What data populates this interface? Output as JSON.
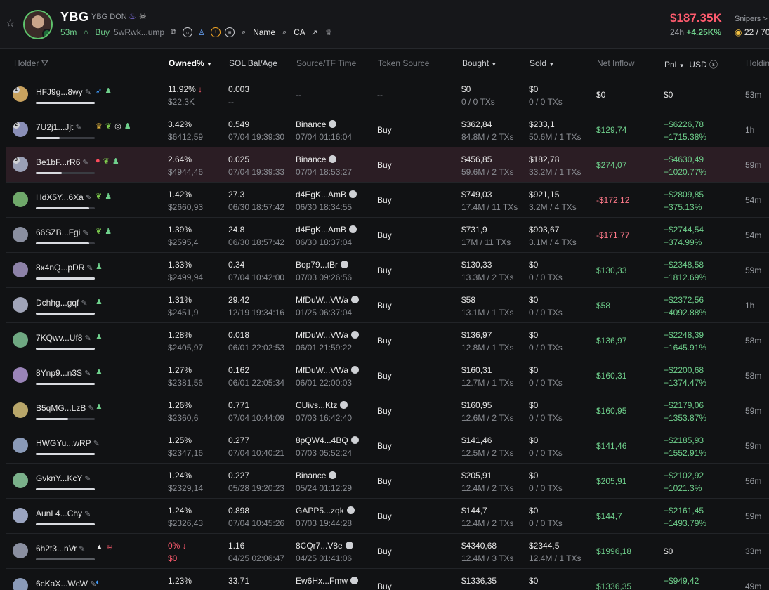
{
  "header": {
    "symbol": "YBG",
    "name": "YBG DON",
    "age": "53m",
    "buy_label": "Buy",
    "address": "5wRwk...ump",
    "name_link": "Name",
    "ca_link": "CA",
    "price": "$187.35K",
    "change_period": "24h",
    "change_value": "+4.25K%",
    "snipers_label": "Snipers >",
    "snipers_value": "22 / 70"
  },
  "columns": {
    "holder": "Holder",
    "owned": "Owned%",
    "sol": "SOL Bal/Age",
    "source": "Source/TF Time",
    "token_source": "Token Source",
    "bought": "Bought",
    "sold": "Sold",
    "inflow": "Net Inflow",
    "pnl": "Pnl",
    "usd": "USD",
    "holding": "Holdin"
  },
  "rows": [
    {
      "rank": "1",
      "addr": "HFJ9g...8wy",
      "bar": 1.0,
      "owned": "11.92%",
      "owned_dir": "down",
      "usd": "$22.3K",
      "sol": "0.003",
      "sol_age": "--",
      "src": "--",
      "src_time": "",
      "token_src": "--",
      "bought": "$0",
      "bought_tx": "0 / 0 TXs",
      "sold": "$0",
      "sold_tx": "0 / 0 TXs",
      "inflow": "$0",
      "inflow_kind": "plain",
      "pnl": "$0",
      "pnl_pct": "",
      "hold": "53m",
      "av": "#c9a25e",
      "tags": [
        "fish",
        "person"
      ]
    },
    {
      "rank": "2",
      "addr": "7U2j1...Jjt",
      "bar": 0.4,
      "owned": "3.42%",
      "usd": "$6412,59",
      "sol": "0.549",
      "sol_age": "07/04 19:39:30",
      "src": "Binance",
      "src_time": "07/04 01:16:04",
      "token_src": "Buy",
      "bought": "$362,84",
      "bought_tx": "84.8M / 2 TXs",
      "sold": "$233,1",
      "sold_tx": "50.6M / 1 TXs",
      "inflow": "$129,74",
      "inflow_kind": "pos",
      "pnl": "+$6226,78",
      "pnl_pct": "+1715.38%",
      "hold": "1h",
      "av": "#8a8fb8",
      "tags": [
        "crown",
        "leaf",
        "target",
        "person"
      ]
    },
    {
      "rank": "3",
      "addr": "Be1bF...rR6",
      "bar": 0.44,
      "owned": "2.64%",
      "usd": "$4944,46",
      "sol": "0.025",
      "sol_age": "07/04 19:39:33",
      "src": "Binance",
      "src_time": "07/04 18:53:27",
      "token_src": "Buy",
      "bought": "$456,85",
      "bought_tx": "59.6M / 2 TXs",
      "sold": "$182,78",
      "sold_tx": "33.2M / 1 TXs",
      "inflow": "$274,07",
      "inflow_kind": "pos",
      "pnl": "+$4630,49",
      "pnl_pct": "+1020.77%",
      "hold": "59m",
      "av": "#9aa0b6",
      "tags": [
        "alert",
        "leaf",
        "person"
      ],
      "highlight": true
    },
    {
      "rank": "",
      "addr": "HdX5Y...6Xa",
      "bar": 0.9,
      "owned": "1.42%",
      "usd": "$2660,93",
      "sol": "27.3",
      "sol_age": "06/30 18:57:42",
      "src": "d4EgK...AmB",
      "src_time": "06/30 18:34:55",
      "token_src": "Buy",
      "bought": "$749,03",
      "bought_tx": "17.4M / 11 TXs",
      "sold": "$921,15",
      "sold_tx": "3.2M / 4 TXs",
      "inflow": "-$172,12",
      "inflow_kind": "neg",
      "pnl": "+$2809,85",
      "pnl_pct": "+375.13%",
      "hold": "54m",
      "av": "#6fa86a",
      "tags": [
        "leaf",
        "person"
      ]
    },
    {
      "rank": "",
      "addr": "66SZB...Fgi",
      "bar": 0.9,
      "owned": "1.39%",
      "usd": "$2595,4",
      "sol": "24.8",
      "sol_age": "06/30 18:57:42",
      "src": "d4EgK...AmB",
      "src_time": "06/30 18:37:04",
      "token_src": "Buy",
      "bought": "$731,9",
      "bought_tx": "17M / 11 TXs",
      "sold": "$903,67",
      "sold_tx": "3.1M / 4 TXs",
      "inflow": "-$171,77",
      "inflow_kind": "neg",
      "pnl": "+$2744,54",
      "pnl_pct": "+374.99%",
      "hold": "54m",
      "av": "#8a8fa0",
      "tags": [
        "leaf",
        "person"
      ]
    },
    {
      "rank": "",
      "addr": "8x4nQ...pDR",
      "bar": 1.0,
      "owned": "1.33%",
      "usd": "$2499,94",
      "sol": "0.34",
      "sol_age": "07/04 10:42:00",
      "src": "Bop79...tBr",
      "src_time": "07/03 09:26:56",
      "token_src": "Buy",
      "bought": "$130,33",
      "bought_tx": "13.3M / 2 TXs",
      "sold": "$0",
      "sold_tx": "0 / 0 TXs",
      "inflow": "$130,33",
      "inflow_kind": "pos",
      "pnl": "+$2348,58",
      "pnl_pct": "+1812.69%",
      "hold": "59m",
      "av": "#8d82a8",
      "tags": [
        "person"
      ]
    },
    {
      "rank": "",
      "addr": "Dchhg...gqf",
      "bar": 1.0,
      "owned": "1.31%",
      "usd": "$2451,9",
      "sol": "29.42",
      "sol_age": "12/19 19:34:16",
      "src": "MfDuW...VWa",
      "src_time": "01/25 06:37:04",
      "token_src": "Buy",
      "bought": "$58",
      "bought_tx": "13.1M / 1 TXs",
      "sold": "$0",
      "sold_tx": "0 / 0 TXs",
      "inflow": "$58",
      "inflow_kind": "pos",
      "pnl": "+$2372,56",
      "pnl_pct": "+4092.88%",
      "hold": "1h",
      "av": "#a0a4b8",
      "tags": [
        "person"
      ]
    },
    {
      "rank": "",
      "addr": "7KQwv...Uf8",
      "bar": 1.0,
      "owned": "1.28%",
      "usd": "$2405,97",
      "sol": "0.018",
      "sol_age": "06/01 22:02:53",
      "src": "MfDuW...VWa",
      "src_time": "06/01 21:59:22",
      "token_src": "Buy",
      "bought": "$136,97",
      "bought_tx": "12.8M / 1 TXs",
      "sold": "$0",
      "sold_tx": "0 / 0 TXs",
      "inflow": "$136,97",
      "inflow_kind": "pos",
      "pnl": "+$2248,39",
      "pnl_pct": "+1645.91%",
      "hold": "58m",
      "av": "#6fa882",
      "tags": [
        "person"
      ]
    },
    {
      "rank": "",
      "addr": "8Ynp9...n3S",
      "bar": 1.0,
      "owned": "1.27%",
      "usd": "$2381,56",
      "sol": "0.162",
      "sol_age": "06/01 22:05:34",
      "src": "MfDuW...VWa",
      "src_time": "06/01 22:00:03",
      "token_src": "Buy",
      "bought": "$160,31",
      "bought_tx": "12.7M / 1 TXs",
      "sold": "$0",
      "sold_tx": "0 / 0 TXs",
      "inflow": "$160,31",
      "inflow_kind": "pos",
      "pnl": "+$2200,68",
      "pnl_pct": "+1374.47%",
      "hold": "58m",
      "av": "#9a84b8",
      "tags": [
        "person"
      ]
    },
    {
      "rank": "",
      "addr": "B5qMG...LzB",
      "bar": 0.55,
      "owned": "1.26%",
      "usd": "$2360,6",
      "sol": "0.771",
      "sol_age": "07/04 10:44:09",
      "src": "CUivs...Ktz",
      "src_time": "07/03 16:42:40",
      "token_src": "Buy",
      "bought": "$160,95",
      "bought_tx": "12.6M / 2 TXs",
      "sold": "$0",
      "sold_tx": "0 / 0 TXs",
      "inflow": "$160,95",
      "inflow_kind": "pos",
      "pnl": "+$2179,06",
      "pnl_pct": "+1353.87%",
      "hold": "59m",
      "av": "#b8a66a",
      "tags": [
        "person"
      ]
    },
    {
      "rank": "",
      "addr": "HWGYu...wRP",
      "bar": 1.0,
      "owned": "1.25%",
      "usd": "$2347,16",
      "sol": "0.277",
      "sol_age": "07/04 10:40:21",
      "src": "8pQW4...4BQ",
      "src_time": "07/03 05:52:24",
      "token_src": "Buy",
      "bought": "$141,46",
      "bought_tx": "12.5M / 2 TXs",
      "sold": "$0",
      "sold_tx": "0 / 0 TXs",
      "inflow": "$141,46",
      "inflow_kind": "pos",
      "pnl": "+$2185,93",
      "pnl_pct": "+1552.91%",
      "hold": "59m",
      "av": "#8a9ab8",
      "tags": []
    },
    {
      "rank": "",
      "addr": "GvknY...KcY",
      "bar": 1.0,
      "owned": "1.24%",
      "usd": "$2329,14",
      "sol": "0.227",
      "sol_age": "05/28 19:20:23",
      "src": "Binance",
      "src_time": "05/24 01:12:29",
      "token_src": "Buy",
      "bought": "$205,91",
      "bought_tx": "12.4M / 2 TXs",
      "sold": "$0",
      "sold_tx": "0 / 0 TXs",
      "inflow": "$205,91",
      "inflow_kind": "pos",
      "pnl": "+$2102,92",
      "pnl_pct": "+1021.3%",
      "hold": "56m",
      "av": "#7ab08a",
      "tags": []
    },
    {
      "rank": "",
      "addr": "AunL4...Chy",
      "bar": 1.0,
      "owned": "1.24%",
      "usd": "$2326,43",
      "sol": "0.898",
      "sol_age": "07/04 10:45:26",
      "src": "GAPP5...zqk",
      "src_time": "07/03 19:44:28",
      "token_src": "Buy",
      "bought": "$144,7",
      "bought_tx": "12.4M / 2 TXs",
      "sold": "$0",
      "sold_tx": "0 / 0 TXs",
      "inflow": "$144,7",
      "inflow_kind": "pos",
      "pnl": "+$2161,45",
      "pnl_pct": "+1493.79%",
      "hold": "59m",
      "av": "#9aa4c0",
      "tags": []
    },
    {
      "rank": "",
      "addr": "6h2t3...nVr",
      "bar": 1.0,
      "dim": true,
      "owned": "0%",
      "owned_dir": "down",
      "owned_red": true,
      "usd": "$0",
      "usd_red": true,
      "sol": "1.16",
      "sol_age": "04/25 02:06:47",
      "src": "8CQr7...V8e",
      "src_time": "04/25 01:41:06",
      "token_src": "Buy",
      "bought": "$4340,68",
      "bought_tx": "12.4M / 3 TXs",
      "sold": "$2344,5",
      "sold_tx": "12.4M / 1 TXs",
      "inflow": "$1996,18",
      "inflow_kind": "pos",
      "pnl": "$0",
      "pnl_pct": "",
      "hold": "33m",
      "av": "#8a8fa0",
      "tags": [
        "triangle",
        "stack"
      ]
    },
    {
      "rank": "",
      "addr": "6cKaX...WcW",
      "bar": 1.0,
      "owned": "1.23%",
      "usd": "",
      "sol": "33.71",
      "sol_age": "",
      "src": "Ew6Hx...Fmw",
      "src_time": "",
      "token_src": "Buy",
      "bought": "$1336,35",
      "bought_tx": "",
      "sold": "$0",
      "sold_tx": "",
      "inflow": "$1336,35",
      "inflow_kind": "pos",
      "pnl": "+$949,42",
      "pnl_pct": "",
      "hold": "49m",
      "av": "#8a9ab8",
      "tags": [
        "blue"
      ]
    }
  ]
}
